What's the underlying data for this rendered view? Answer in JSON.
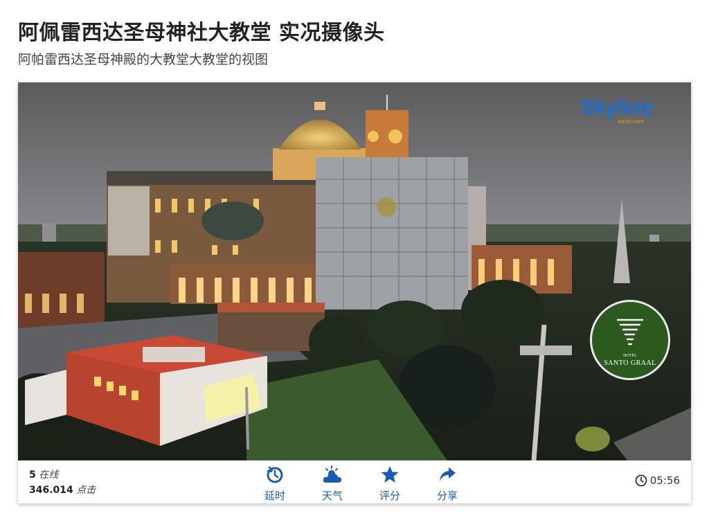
{
  "page": {
    "title": "阿佩雷西达圣母神社大教堂 实况摄像头",
    "subtitle": "阿帕雷西达圣母神殿的大教堂大教堂的视图"
  },
  "video": {
    "logo_text": "Skyline",
    "logo_tagline": "WEBCAMS",
    "hotel_badge": {
      "small_text": "HOTEL",
      "name": "SANTO GRAAL",
      "icon": "tornado-icon"
    }
  },
  "stats": {
    "online_count": "5",
    "online_label": "在线",
    "views_count": "346.014",
    "views_label": "点击"
  },
  "controls": [
    {
      "id": "timelapse",
      "label": "延时",
      "icon": "timelapse-icon"
    },
    {
      "id": "weather",
      "label": "天气",
      "icon": "weather-icon"
    },
    {
      "id": "rating",
      "label": "评分",
      "icon": "star-icon"
    },
    {
      "id": "share",
      "label": "分享",
      "icon": "share-icon"
    }
  ],
  "clock": {
    "time": "05:56",
    "icon": "clock-icon"
  },
  "colors": {
    "accent": "#1a5bb5",
    "skyline_blue": "#1b6fd1",
    "skyline_orange": "#f39a1b",
    "badge_green": "#2c5a1e"
  }
}
